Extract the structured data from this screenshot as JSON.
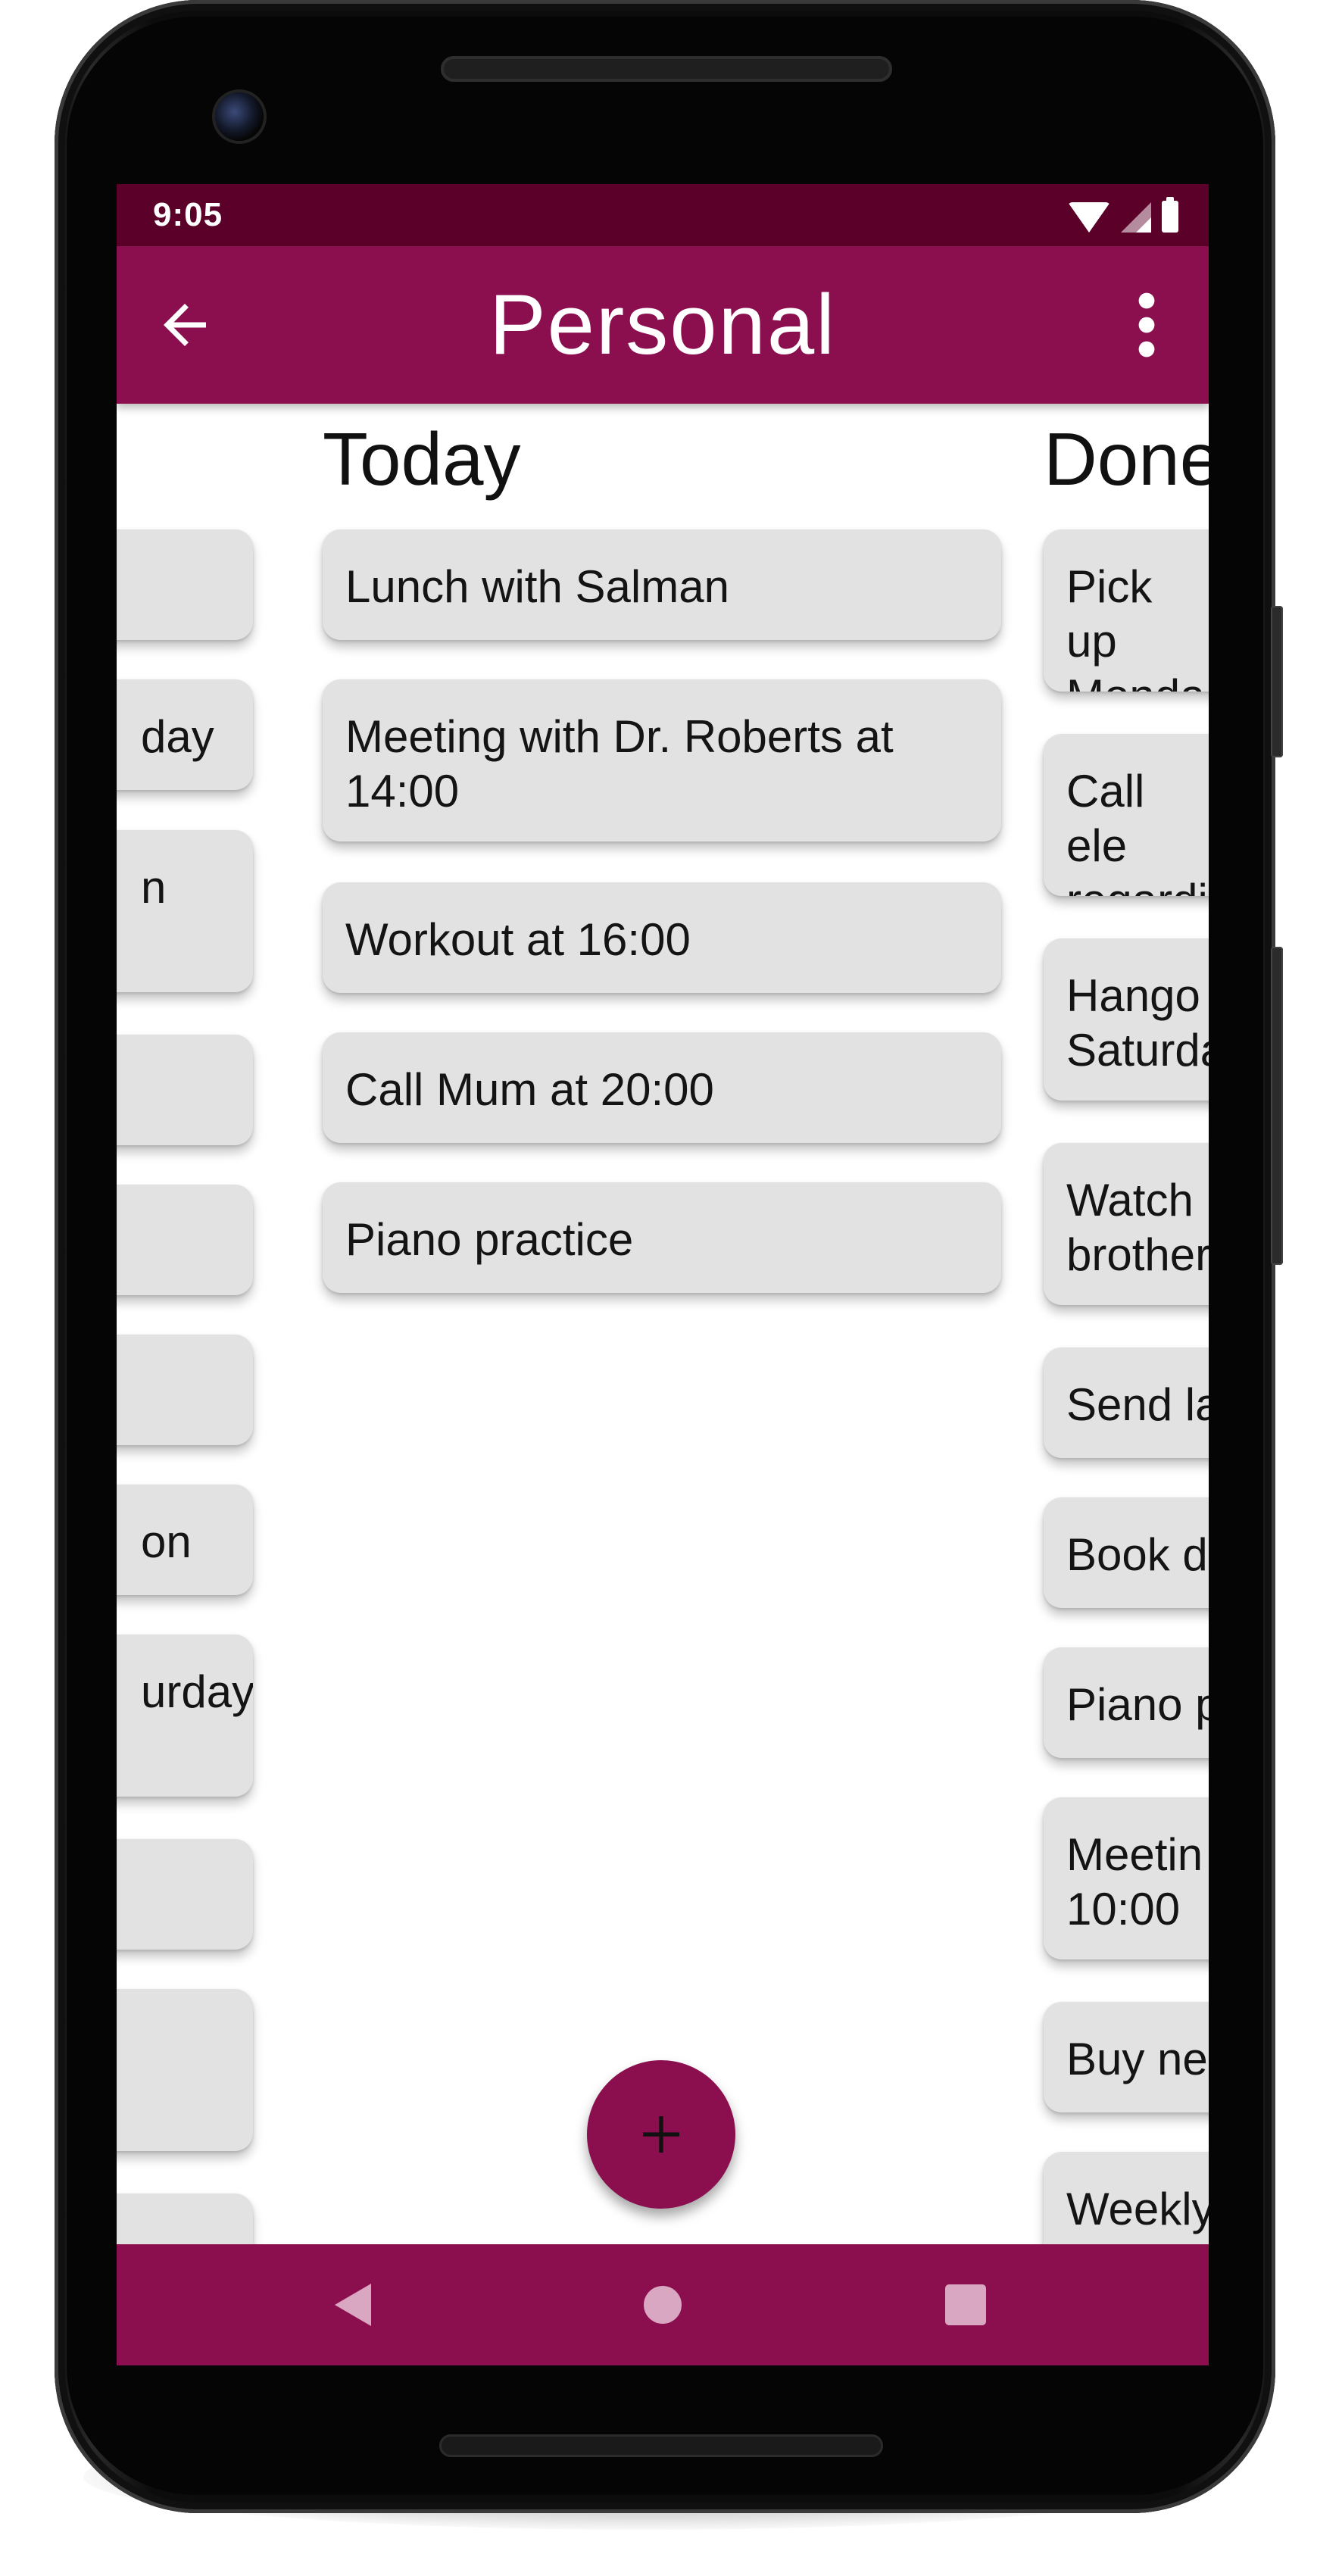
{
  "status_bar": {
    "time": "9:05"
  },
  "app_bar": {
    "title": "Personal",
    "back_icon": "arrow-left-icon",
    "menu_icon": "more-vert-icon"
  },
  "columns": [
    {
      "title": "",
      "cards": [
        {
          "text": ""
        },
        {
          "text": "day"
        },
        {
          "text": "n"
        },
        {
          "text": ""
        },
        {
          "text": ""
        },
        {
          "text": ""
        },
        {
          "text": "on"
        },
        {
          "text": "urday"
        },
        {
          "text": ""
        },
        {
          "text": ""
        },
        {
          "text": ""
        }
      ]
    },
    {
      "title": "Today",
      "cards": [
        {
          "text": "Lunch with Salman"
        },
        {
          "text": "Meeting with Dr. Roberts at 14:00"
        },
        {
          "text": "Workout at 16:00"
        },
        {
          "text": "Call Mum at 20:00"
        },
        {
          "text": "Piano practice"
        }
      ]
    },
    {
      "title": "Done",
      "cards": [
        {
          "text": "Pick up Monda"
        },
        {
          "text": "Call ele regardi"
        },
        {
          "text": "Hango Saturda"
        },
        {
          "text": "Watch brother"
        },
        {
          "text": "Send la"
        },
        {
          "text": "Book d"
        },
        {
          "text": "Piano p"
        },
        {
          "text": "Meetin 10:00"
        },
        {
          "text": "Buy ne"
        },
        {
          "text": "Weekly"
        }
      ]
    }
  ],
  "fab": {
    "icon": "plus-icon",
    "label": "+"
  },
  "nav_bar": {
    "back_icon": "nav-back-icon",
    "home_icon": "nav-home-icon",
    "recents_icon": "nav-recents-icon"
  },
  "colors": {
    "primary": "#8b0f4e",
    "primary_dark": "#5b0029",
    "card": "#e2e2e2",
    "nav_icon": "#d9a7c1"
  }
}
